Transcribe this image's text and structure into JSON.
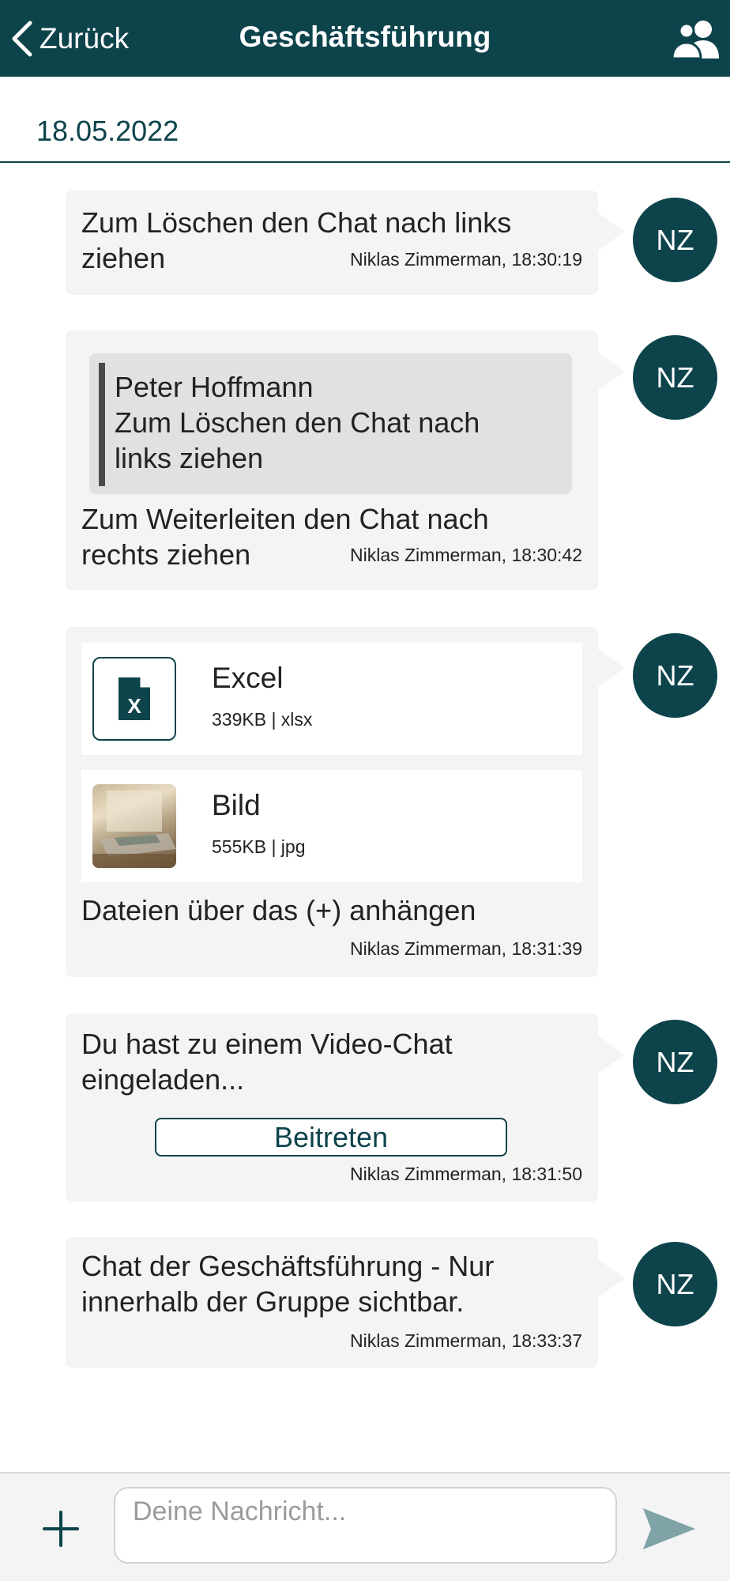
{
  "header": {
    "back_label": "Zurück",
    "title": "Geschäftsführung",
    "back_icon": "chevron-left-icon",
    "group_icon": "users-icon"
  },
  "date_label": "18.05.2022",
  "colors": {
    "primary": "#0d444c",
    "bubble_bg": "#f4f4f4",
    "quote_bg": "#e2e1e0",
    "send_icon": "#7fa3a7"
  },
  "messages": [
    {
      "avatar": "NZ",
      "text": "Zum Löschen den Chat nach links ziehen",
      "text_lines": [
        "Zum Löschen den Chat nach links",
        "ziehen"
      ],
      "meta": "Niklas Zimmerman, 18:30:19"
    },
    {
      "avatar": "NZ",
      "quote": {
        "author": "Peter Hoffmann",
        "lines": [
          "Zum Löschen den Chat nach",
          "links ziehen"
        ]
      },
      "text_lines": [
        "Zum Weiterleiten den Chat nach",
        "rechts ziehen"
      ],
      "meta": "Niklas Zimmerman, 18:30:42"
    },
    {
      "avatar": "NZ",
      "files": [
        {
          "name": "Excel",
          "meta": "339KB | xlsx",
          "icon": "excel-file-icon"
        },
        {
          "name": "Bild",
          "meta": "555KB | jpg",
          "icon": "image-thumbnail"
        }
      ],
      "text": "Dateien über das (+) anhängen",
      "meta": "Niklas Zimmerman, 18:31:39"
    },
    {
      "avatar": "NZ",
      "text_lines": [
        "Du hast zu einem Video-Chat",
        "eingeladen..."
      ],
      "button_label": "Beitreten",
      "meta": "Niklas Zimmerman, 18:31:50"
    },
    {
      "avatar": "NZ",
      "text_lines": [
        "Chat der Geschäftsführung - Nur",
        "innerhalb der Gruppe sichtbar."
      ],
      "meta": "Niklas Zimmerman, 18:33:37"
    }
  ],
  "composer": {
    "placeholder": "Deine Nachricht...",
    "value": "",
    "add_icon": "plus-icon",
    "send_icon": "send-icon"
  }
}
